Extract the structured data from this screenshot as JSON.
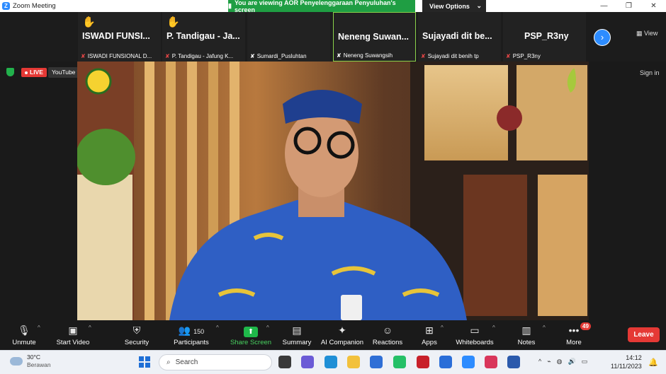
{
  "titlebar": {
    "app_title": "Zoom Meeting",
    "logo_letter": "Z",
    "win_minimize": "—",
    "win_maximize": "❐",
    "win_close": "✕"
  },
  "share_banner": {
    "text": "You are viewing AOR Penyelenggaraan Penyuluhan's screen",
    "view_options_label": "View Options"
  },
  "participants_strip": {
    "tiles": [
      {
        "big_name": "ISWADI FUNSI...",
        "small_name": "ISWADI FUNSIONAL D...",
        "hand_raised": true,
        "muted": true
      },
      {
        "big_name": "P. Tandigau - Ja...",
        "small_name": "P. Tandigau - Jafung K...",
        "hand_raised": true,
        "muted": true
      },
      {
        "big_name": "",
        "small_name": "Sumardi_Pusluhtan",
        "hand_raised": false,
        "muted": true
      },
      {
        "big_name": "Neneng Suwan...",
        "small_name": "Neneng Suwangsih",
        "hand_raised": false,
        "muted": true,
        "active": true
      },
      {
        "big_name": "Sujayadi dit be...",
        "small_name": "Sujayadi dit benih tp",
        "hand_raised": false,
        "muted": true
      },
      {
        "big_name": "PSP_R3ny",
        "small_name": "PSP_R3ny",
        "hand_raised": false,
        "muted": true
      }
    ],
    "next_icon": "›",
    "view_label": "View"
  },
  "stream": {
    "live_label": "LIVE",
    "youtube_label": "YouTube",
    "sign_in_label": "Sign in"
  },
  "controls": {
    "unmute": "Unmute",
    "start_video": "Start Video",
    "security": "Security",
    "participants_label": "Participants",
    "participants_count": "150",
    "share_screen": "Share Screen",
    "summary": "Summary",
    "ai_companion": "AI Companion",
    "reactions": "Reactions",
    "apps": "Apps",
    "whiteboards": "Whiteboards",
    "notes": "Notes",
    "more": "More",
    "more_badge": "49",
    "leave": "Leave"
  },
  "taskbar": {
    "weather_temp": "30°C",
    "weather_desc": "Berawan",
    "search_placeholder": "Search",
    "time": "14:12",
    "date": "11/11/2023",
    "pinned_apps": [
      {
        "name": "task-view-icon",
        "color": "#3a3a3a"
      },
      {
        "name": "chat-icon",
        "color": "#6b5bd6"
      },
      {
        "name": "edge-icon",
        "color": "#1f8fd6"
      },
      {
        "name": "file-explorer-icon",
        "color": "#f2c13c"
      },
      {
        "name": "store-icon",
        "color": "#2f6fd6"
      },
      {
        "name": "whatsapp-icon",
        "color": "#25c067"
      },
      {
        "name": "mcafee-icon",
        "color": "#c8202a"
      },
      {
        "name": "mcafee-security-icon",
        "color": "#2a6ed8"
      },
      {
        "name": "zoom-icon",
        "color": "#2d8cff"
      },
      {
        "name": "snipping-tool-icon",
        "color": "#d9365b"
      },
      {
        "name": "word-icon",
        "color": "#2b5aac"
      }
    ],
    "tray_icons": [
      "^",
      "⌁",
      "◍",
      "🔊",
      "▭"
    ]
  },
  "colors": {
    "accent": "#2d8cff",
    "live_red": "#e53935",
    "share_green": "#1fb84a",
    "raised_hand": "#f4c41b"
  }
}
